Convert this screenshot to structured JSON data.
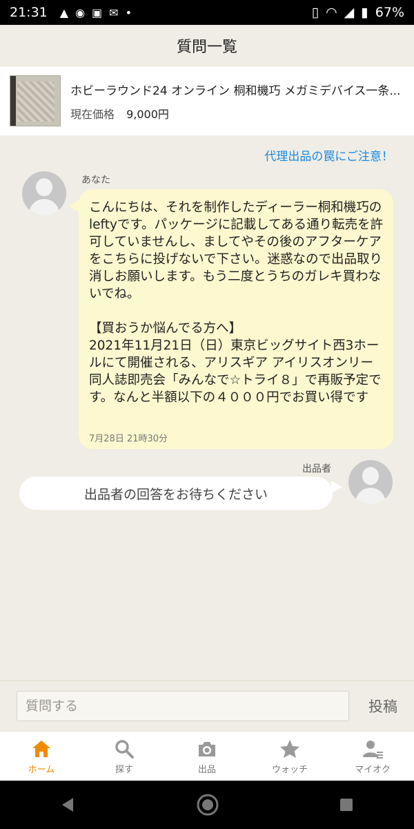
{
  "status_bar": {
    "time": "21:31",
    "battery": "67%"
  },
  "header": {
    "title": "質問一覧"
  },
  "product": {
    "title": "ホビーラウンド24 オンライン 桐和機巧 メガミデバイス一条...",
    "price_label": "現在価格",
    "price": "9,000円"
  },
  "warning_link": "代理出品の罠にご注意！",
  "conversation": {
    "me_label": "あなた",
    "message": "こんにちは、それを制作したディーラー桐和機巧のleftyです。パッケージに記載してある通り転売を許可していませんし、ましてやその後のアフターケアをこちらに投げないで下さい。迷惑なので出品取り消しお願いします。もう二度とうちのガレキ買わないでね。\n\n【買おうか悩んでる方へ】\n2021年11月21日（日）東京ビッグサイト西3ホールにて開催される、アリスギア アイリスオンリー同人誌即売会「みんなで☆トライ８」で再販予定です。なんと半額以下の４０００円でお買い得です",
    "timestamp": "7月28日 21時30分",
    "seller_label": "出品者",
    "seller_reply": "出品者の回答をお待ちください"
  },
  "input": {
    "placeholder": "質問する",
    "post_label": "投稿"
  },
  "bottom_nav": {
    "items": [
      {
        "label": "ホーム",
        "icon": "home-icon",
        "active": true
      },
      {
        "label": "探す",
        "icon": "search-icon",
        "active": false
      },
      {
        "label": "出品",
        "icon": "camera-icon",
        "active": false
      },
      {
        "label": "ウォッチ",
        "icon": "star-icon",
        "active": false
      },
      {
        "label": "マイオク",
        "icon": "user-list-icon",
        "active": false
      }
    ]
  },
  "colors": {
    "accent": "#f08a00",
    "link": "#1a8ae0",
    "bubble": "#fdf8cf",
    "background": "#efede5"
  }
}
